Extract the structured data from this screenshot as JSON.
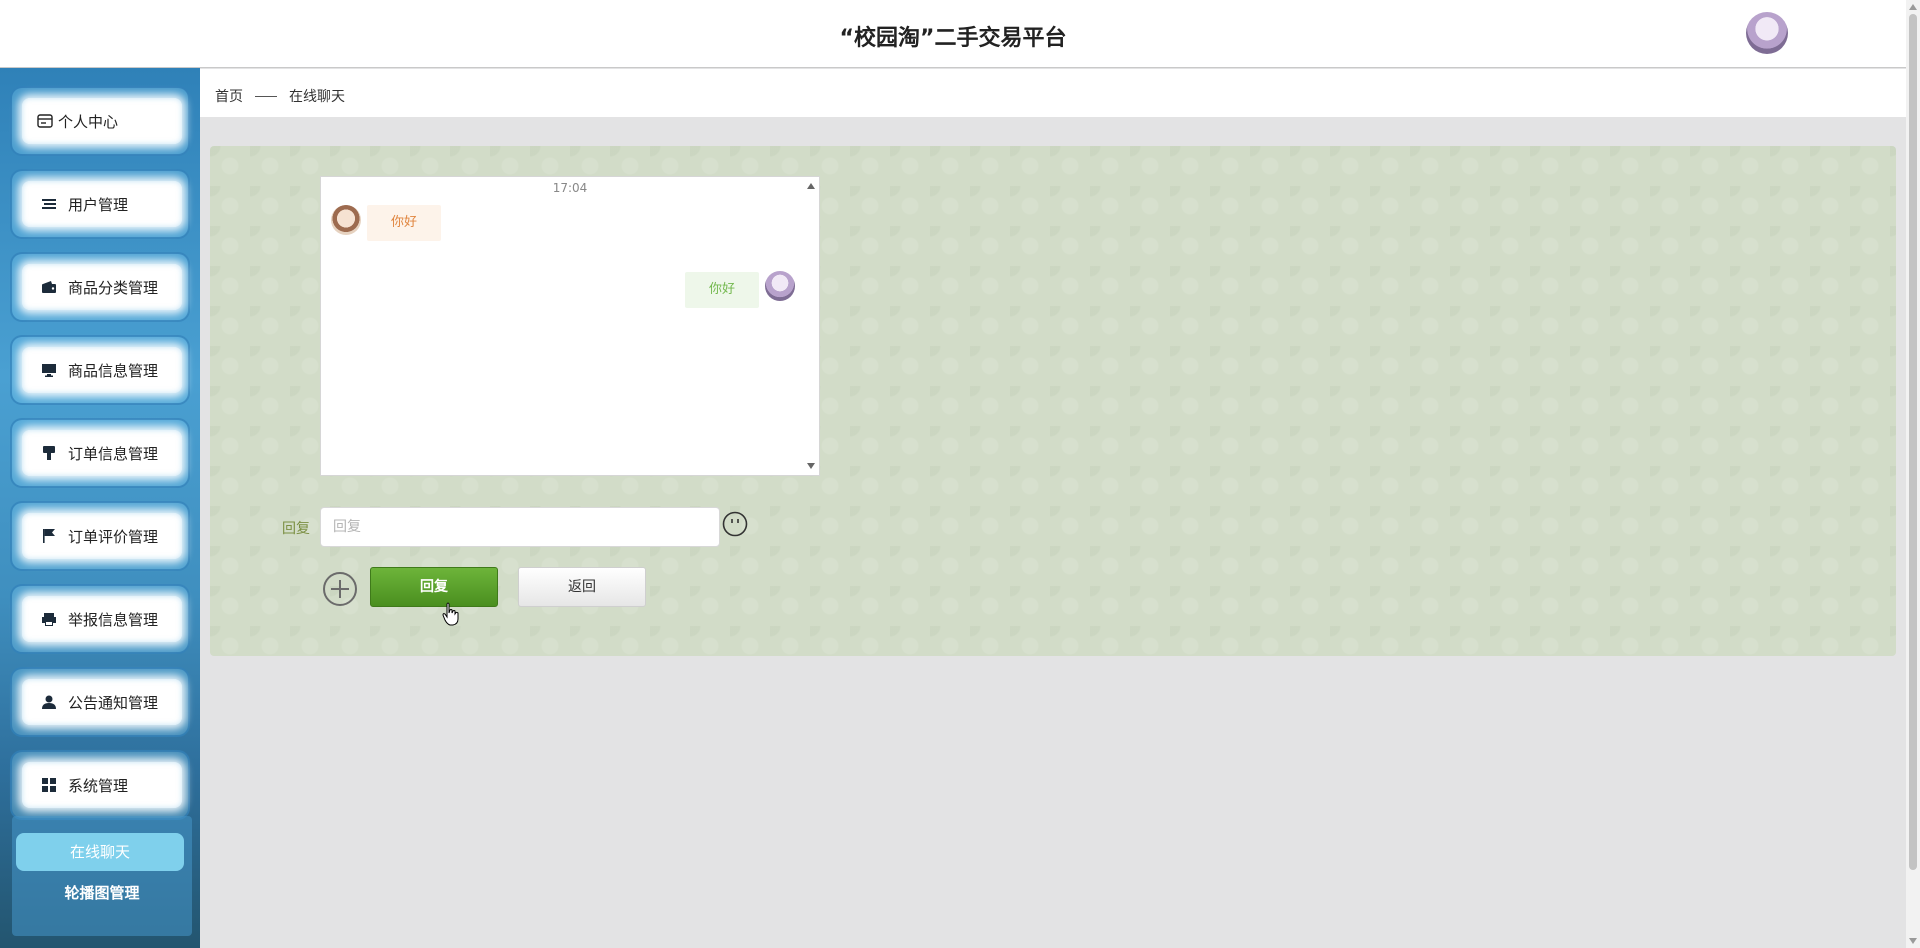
{
  "header": {
    "title": "“校园淘”二手交易平台"
  },
  "sidebar": {
    "items": [
      {
        "label": "个人中心",
        "icon": "id-card-icon"
      },
      {
        "label": "用户管理",
        "icon": "list-icon"
      },
      {
        "label": "商品分类管理",
        "icon": "wallet-icon"
      },
      {
        "label": "商品信息管理",
        "icon": "monitor-icon"
      },
      {
        "label": "订单信息管理",
        "icon": "stamp-icon"
      },
      {
        "label": "订单评价管理",
        "icon": "flag-icon"
      },
      {
        "label": "举报信息管理",
        "icon": "printer-icon"
      },
      {
        "label": "公告通知管理",
        "icon": "user-icon"
      },
      {
        "label": "系统管理",
        "icon": "grid-icon"
      }
    ],
    "submenu": {
      "active": "在线聊天",
      "inactive": "轮播图管理"
    }
  },
  "breadcrumb": {
    "home": "首页",
    "current": "在线聊天"
  },
  "chat": {
    "time": "17:04",
    "messages": [
      {
        "side": "left",
        "text": "你好"
      },
      {
        "side": "right",
        "text": "你好"
      }
    ]
  },
  "form": {
    "reply_label": "回复",
    "reply_placeholder": "回复",
    "reply_button": "回复",
    "back_button": "返回"
  },
  "colors": {
    "sidebar_accent": "#4aa0d2",
    "reply_button": "#5aa12b",
    "active_menu": "#7fd0ec",
    "panel_bg": "#d2dcc8"
  }
}
